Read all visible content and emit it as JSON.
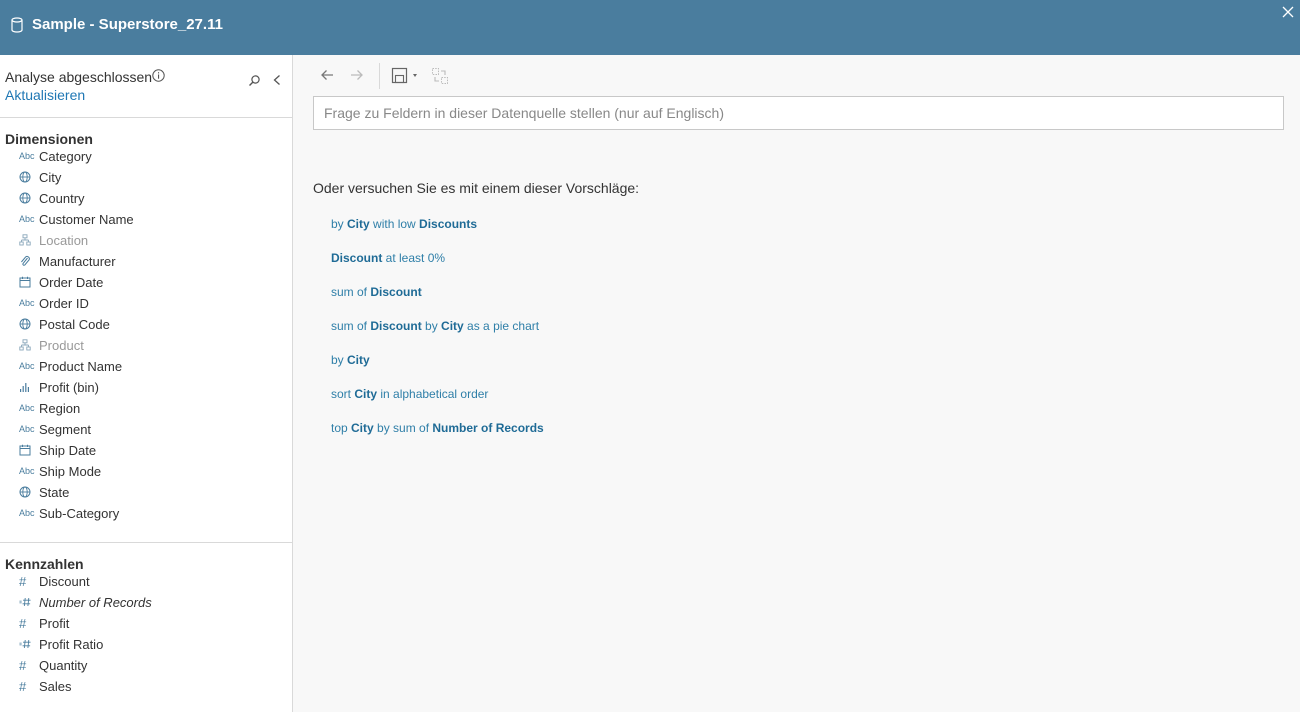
{
  "window": {
    "title": "Sample - Superstore_27.11",
    "accent": "#4a7d9e"
  },
  "sidebar": {
    "status": "Analyse abgeschlossen",
    "refresh_label": "Aktualisieren",
    "dimensions_title": "Dimensionen",
    "measures_title": "Kennzahlen",
    "dimensions": [
      {
        "name": "Category",
        "icon": "abc-icon"
      },
      {
        "name": "City",
        "icon": "globe-icon"
      },
      {
        "name": "Country",
        "icon": "globe-icon"
      },
      {
        "name": "Customer Name",
        "icon": "abc-icon"
      },
      {
        "name": "Location",
        "icon": "hierarchy-icon"
      },
      {
        "name": "Manufacturer",
        "icon": "paperclip-icon"
      },
      {
        "name": "Order Date",
        "icon": "calendar-icon"
      },
      {
        "name": "Order ID",
        "icon": "abc-icon"
      },
      {
        "name": "Postal Code",
        "icon": "globe-icon"
      },
      {
        "name": "Product",
        "icon": "hierarchy-icon"
      },
      {
        "name": "Product Name",
        "icon": "abc-icon"
      },
      {
        "name": "Profit (bin)",
        "icon": "histogram-icon"
      },
      {
        "name": "Region",
        "icon": "abc-icon"
      },
      {
        "name": "Segment",
        "icon": "abc-icon"
      },
      {
        "name": "Ship Date",
        "icon": "calendar-icon"
      },
      {
        "name": "Ship Mode",
        "icon": "abc-icon"
      },
      {
        "name": "State",
        "icon": "globe-icon"
      },
      {
        "name": "Sub-Category",
        "icon": "abc-icon"
      }
    ],
    "measures": [
      {
        "name": "Discount",
        "icon": "hash-icon"
      },
      {
        "name": "Number of Records",
        "icon": "calc-hash-icon"
      },
      {
        "name": "Profit",
        "icon": "hash-icon"
      },
      {
        "name": "Profit Ratio",
        "icon": "calc-hash-icon"
      },
      {
        "name": "Quantity",
        "icon": "hash-icon"
      },
      {
        "name": "Sales",
        "icon": "hash-icon"
      }
    ]
  },
  "main": {
    "search_placeholder": "Frage zu Feldern in dieser Datenquelle stellen (nur auf Englisch)",
    "suggestions_heading": "Oder versuchen Sie es mit einem dieser Vorschläge:",
    "suggestions": [
      {
        "parts": [
          {
            "t": "by "
          },
          {
            "t": "City",
            "b": true
          },
          {
            "t": " with low "
          },
          {
            "t": "Discounts",
            "b": true
          }
        ]
      },
      {
        "parts": [
          {
            "t": "Discount",
            "b": true
          },
          {
            "t": " at least 0%"
          }
        ]
      },
      {
        "parts": [
          {
            "t": "sum of "
          },
          {
            "t": "Discount",
            "b": true
          }
        ]
      },
      {
        "parts": [
          {
            "t": "sum of "
          },
          {
            "t": "Discount",
            "b": true
          },
          {
            "t": " by "
          },
          {
            "t": "City",
            "b": true
          },
          {
            "t": " as a pie chart"
          }
        ]
      },
      {
        "parts": [
          {
            "t": "by "
          },
          {
            "t": "City",
            "b": true
          }
        ]
      },
      {
        "parts": [
          {
            "t": "sort "
          },
          {
            "t": "City",
            "b": true
          },
          {
            "t": " in alphabetical order"
          }
        ]
      },
      {
        "parts": [
          {
            "t": "top "
          },
          {
            "t": "City",
            "b": true
          },
          {
            "t": " by sum of "
          },
          {
            "t": "Number of Records",
            "b": true
          }
        ]
      }
    ]
  }
}
